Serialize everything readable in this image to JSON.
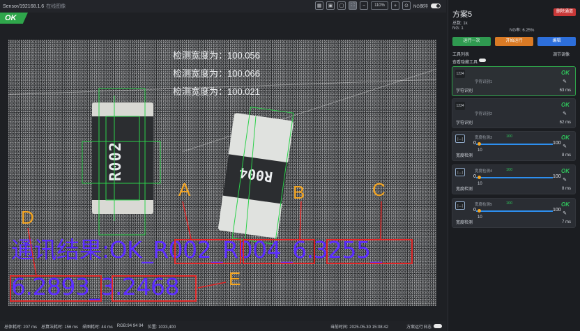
{
  "topbar": {
    "sensor": "Sensor/192168.1.6",
    "status": "在线图像",
    "zoom": "110%",
    "ng_label": "NG保持"
  },
  "result_banner": "OK",
  "image": {
    "measurements": [
      "检测宽度为：100.056",
      "检测宽度为：100.066",
      "检测宽度为：100.021"
    ],
    "chip1_code": "R002",
    "chip2_code": "R004",
    "ocr_line1_parts": [
      "通讯结果:OK_",
      "R002",
      "_",
      "R004",
      "_",
      "6.3255",
      "_"
    ],
    "ocr_line2_parts": [
      "6.2893",
      "_",
      "3.2468"
    ],
    "labels": [
      "A",
      "B",
      "C",
      "D",
      "E"
    ]
  },
  "statusbar": {
    "total_time": "总体耗时: 207 ms",
    "process_time": "总算法耗时: 156 ms",
    "grab_time": "采图耗时: 44 ms",
    "rgb": "RGB:94 94 94",
    "position": "位置: 1033,400",
    "current_time": "当前时间: 2025-05-30 15:08:42",
    "log_label": "方案运行日志"
  },
  "panel": {
    "title": "方案5",
    "delete_label": "删除通道",
    "total_label": "总数: 1k",
    "ng_label": "NG: 1",
    "ng_rate": "NG率: 6.25%",
    "run_once": "运行一次",
    "run_cont": "开始运行",
    "edit": "编辑",
    "tool_list": "工具列表",
    "section_image": "调节调像",
    "show_hidden": "查看隐藏工具"
  },
  "tools": [
    {
      "icon": "1234",
      "name": "字符识别1",
      "type": "字符识别",
      "result": "OK",
      "time": "63 ms"
    },
    {
      "icon": "1234",
      "name": "字符识别2",
      "type": "字符识别",
      "result": "OK",
      "time": "62 ms"
    },
    {
      "icon": "|↔|",
      "name": "宽度检测3",
      "type": "宽度检测",
      "result": "OK",
      "time": "8 ms",
      "value": "100",
      "min": "0",
      "max": "100",
      "low": "10"
    },
    {
      "icon": "|↔|",
      "name": "宽度检测4",
      "type": "宽度检测",
      "result": "OK",
      "time": "8 ms",
      "value": "100",
      "min": "0",
      "max": "100",
      "low": "10"
    },
    {
      "icon": "|↔|",
      "name": "宽度检测5",
      "type": "宽度检测",
      "result": "OK",
      "time": "7 ms",
      "value": "100",
      "min": "0",
      "max": "100",
      "low": "10"
    }
  ],
  "colors": {
    "ok_green": "#2fa64b",
    "ocr_text": "#5b2cff",
    "highlight_box": "#e02727",
    "label_orange": "#f5a623",
    "delete_red": "#c93838",
    "run_orange": "#d97a25",
    "edit_blue": "#2d6fdb"
  }
}
